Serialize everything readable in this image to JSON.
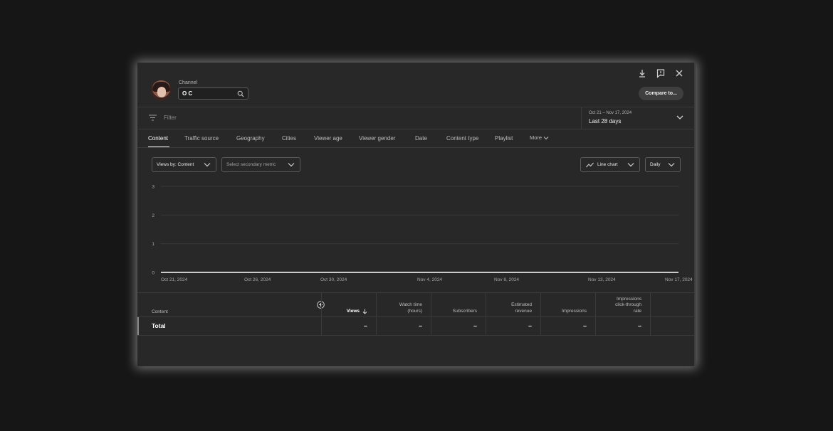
{
  "header": {
    "channel_label": "Channel",
    "channel_value": "O C",
    "compare_label": "Compare to...",
    "icons": [
      "download-icon",
      "feedback-icon",
      "close-icon"
    ]
  },
  "filter": {
    "placeholder": "Filter",
    "date_range": "Oct 21 – Nov 17, 2024",
    "date_label": "Last 28 days"
  },
  "tabs": [
    {
      "label": "Content",
      "active": true
    },
    {
      "label": "Traffic source"
    },
    {
      "label": "Geography"
    },
    {
      "label": "Cities"
    },
    {
      "label": "Viewer age"
    },
    {
      "label": "Viewer gender"
    },
    {
      "label": "Date"
    },
    {
      "label": "Content type"
    },
    {
      "label": "Playlist"
    },
    {
      "label": "More"
    }
  ],
  "controls": {
    "primary_metric": "Views by: Content",
    "secondary_metric": "Select secondary metric",
    "chart_type": "Line chart",
    "interval": "Daily"
  },
  "chart_data": {
    "type": "line",
    "x_ticks": [
      "Oct 21, 2024",
      "Oct 26, 2024",
      "Oct 30, 2024",
      "Nov 4, 2024",
      "Nov 8, 2024",
      "Nov 13, 2024",
      "Nov 17, 2024"
    ],
    "y_ticks": [
      "3",
      "2",
      "1",
      "0"
    ],
    "ylim": [
      0,
      3
    ],
    "series": [
      {
        "values": [
          0,
          0,
          0,
          0,
          0,
          0,
          0,
          0,
          0,
          0,
          0,
          0,
          0,
          0,
          0,
          0,
          0,
          0,
          0,
          0,
          0,
          0,
          0,
          0,
          0,
          0,
          0,
          0
        ]
      }
    ],
    "grid": true
  },
  "table": {
    "content_header": "Content",
    "columns": [
      "Views",
      "Watch time\n(hours)",
      "Subscribers",
      "Estimated\nrevenue",
      "Impressions",
      "Impressions\nclick-through\nrate"
    ],
    "total_label": "Total",
    "total_values": [
      "–",
      "–",
      "–",
      "–",
      "–",
      "–"
    ]
  }
}
